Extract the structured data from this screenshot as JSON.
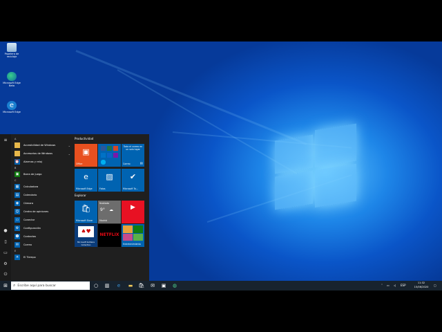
{
  "desktop": {
    "icons": [
      {
        "label": "Papelera de reciclaje",
        "icon": "recycle-bin-icon"
      },
      {
        "label": "Microsoft Edge Beta",
        "icon": "edge-beta-icon"
      },
      {
        "label": "Microsoft Edge",
        "icon": "edge-icon"
      }
    ]
  },
  "start": {
    "app_list": [
      {
        "type": "header",
        "label": "A"
      },
      {
        "type": "item",
        "label": "Accesibilidad de Windows",
        "icon": "folder-icon",
        "expandable": true
      },
      {
        "type": "item",
        "label": "Accesorios de Windows",
        "icon": "folder-icon",
        "expandable": true
      },
      {
        "type": "item",
        "label": "Alarmas y reloj",
        "icon": "alarm-clock-icon",
        "expandable": false
      },
      {
        "type": "header",
        "label": "B"
      },
      {
        "type": "item",
        "label": "Barra de juego",
        "icon": "xbox-game-bar-icon",
        "expandable": false
      },
      {
        "type": "header",
        "label": "C"
      },
      {
        "type": "item",
        "label": "Calculadora",
        "icon": "calculator-icon",
        "expandable": false
      },
      {
        "type": "item",
        "label": "Calendario",
        "icon": "calendar-icon",
        "expandable": false
      },
      {
        "type": "item",
        "label": "Cámara",
        "icon": "camera-icon",
        "expandable": false
      },
      {
        "type": "item",
        "label": "Centro de opiniones",
        "icon": "feedback-hub-icon",
        "expandable": false
      },
      {
        "type": "item",
        "label": "Conectar",
        "icon": "connect-icon",
        "expandable": false
      },
      {
        "type": "item",
        "label": "Configuración",
        "icon": "settings-gear-icon",
        "expandable": false
      },
      {
        "type": "item",
        "label": "Contactos",
        "icon": "contacts-icon",
        "expandable": false
      },
      {
        "type": "item",
        "label": "Correo",
        "icon": "mail-icon",
        "expandable": false
      },
      {
        "type": "header",
        "label": "E"
      },
      {
        "type": "item",
        "label": "El Tiempo",
        "icon": "weather-sun-icon",
        "expandable": false
      }
    ],
    "groups": {
      "productividad": "Productividad",
      "explorar": "Explorar"
    },
    "tiles": {
      "office": "Office",
      "correo_promo": "Todo el correo en un solo lugar",
      "correo": "Correo",
      "edge": "Microsoft Edge",
      "fotos": "Fotos",
      "todo": "Microsoft To...",
      "store": "Microsoft Store",
      "weather_header": "Nublado",
      "weather_temp": "9°",
      "weather_city": "Madrid",
      "netflix": "NETFLIX",
      "solitaire": "Microsoft Solitaire Collection",
      "entretenimiento": "Entretenimiento"
    }
  },
  "taskbar": {
    "search_placeholder": "Escribe aquí para buscar",
    "language": "ESP",
    "time": "11:32",
    "date": "15/06/2020"
  },
  "colors": {
    "accent": "#0078d7",
    "office": "#e8501f",
    "netflix_bg": "#000000",
    "taskbar": "#18232e"
  }
}
